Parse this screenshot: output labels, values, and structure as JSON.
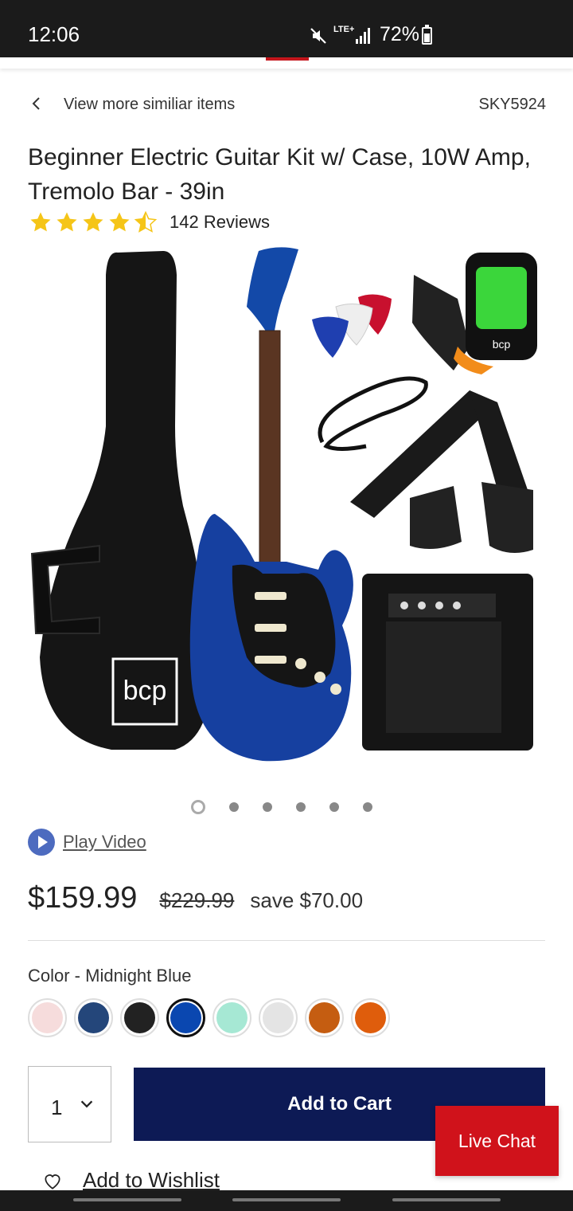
{
  "status_bar": {
    "time": "12:06",
    "network": "LTE+",
    "battery": "72%"
  },
  "nav": {
    "back_link": "View more similiar items",
    "sku": "SKY5924"
  },
  "product": {
    "title": "Beginner Electric Guitar Kit w/ Case, 10W Amp, Tremolo Bar - 39in",
    "rating": 4.5,
    "reviews": "142 Reviews",
    "logo_text": "bcp"
  },
  "gallery": {
    "slide_count": 6,
    "active_slide": 1
  },
  "video": {
    "label": "Play Video"
  },
  "pricing": {
    "price": "$159.99",
    "original_price": "$229.99",
    "savings": "save $70.00"
  },
  "color": {
    "label": "Color - Midnight Blue",
    "swatches": [
      "#f6dcdc",
      "#24467a",
      "#222222",
      "#0a47b0",
      "#a6e8d4",
      "#e4e4e4",
      "#c55d11",
      "#df5d0c"
    ],
    "selected_index": 3
  },
  "cart": {
    "quantity": "1",
    "add_label": "Add to Cart"
  },
  "live_chat": {
    "label": "Live Chat"
  },
  "wishlist": {
    "label": "Add to Wishlist"
  }
}
